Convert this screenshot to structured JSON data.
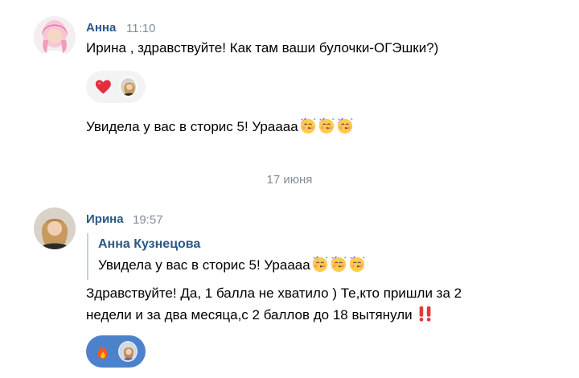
{
  "messages": [
    {
      "author": "Анна",
      "time": "11:10",
      "text": "Ирина , здравствуйте! Как там ваши булочки-ОГЭшки?)",
      "reaction_icons": [
        "heart-emoji-icon",
        "reactor-avatar"
      ],
      "text2": "Увидела у вас в сторис 5! Ураааа",
      "text2_emojis": [
        "partying-face-emoji-icon",
        "partying-face-emoji-icon",
        "partying-face-emoji-icon"
      ]
    },
    {
      "author": "Ирина",
      "time": "19:57",
      "reply": {
        "author": "Анна Кузнецова",
        "text": "Увидела у вас в сторис 5! Ураааа",
        "emojis": [
          "partying-face-emoji-icon",
          "partying-face-emoji-icon",
          "partying-face-emoji-icon"
        ]
      },
      "text": "Здравствуйте! Да, 1 балла не хватило ) Те,кто пришли за 2 недели и за два месяца,с 2 баллов до 18 вытянули",
      "text_emoji": "double-exclamation-emoji-icon",
      "reaction_icons": [
        "fire-emoji-icon",
        "reactor-avatar"
      ]
    }
  ],
  "date_separator": "17 июня",
  "colors": {
    "author": "#2a5885",
    "timestamp": "#818c99",
    "reaction_light": "#f2f3f5",
    "reaction_selected": "#4b82cb"
  }
}
